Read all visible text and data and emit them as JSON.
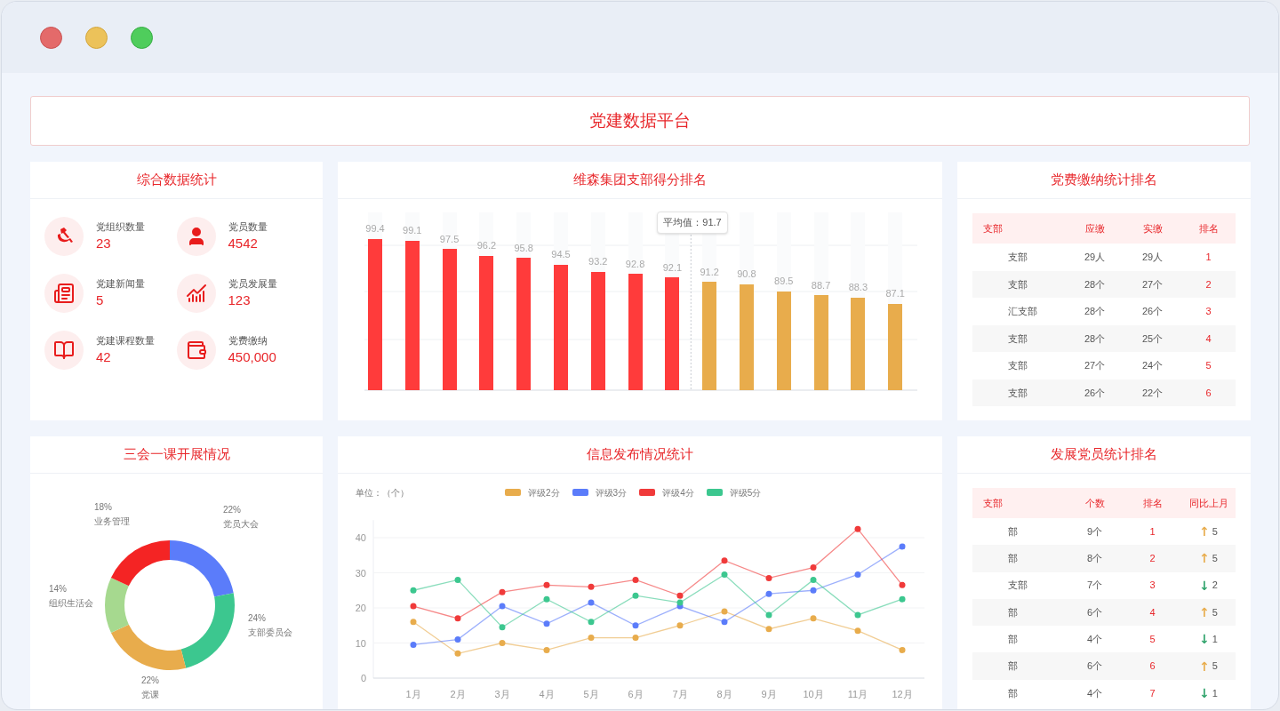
{
  "title": "党建数据平台",
  "stats": {
    "title": "综合数据统计",
    "items": [
      {
        "kind": "party",
        "label": "党组织数量",
        "value": "23"
      },
      {
        "kind": "member",
        "label": "党员数量",
        "value": "4542"
      },
      {
        "kind": "news",
        "label": "党建新闻量",
        "value": "5"
      },
      {
        "kind": "growth",
        "label": "党员发展量",
        "value": "123"
      },
      {
        "kind": "course",
        "label": "党建课程数量",
        "value": "42"
      },
      {
        "kind": "fee",
        "label": "党费缴纳",
        "value": "450,000"
      }
    ]
  },
  "ranking": {
    "title": "维森集团支部得分排名",
    "average": "平均值：91.7",
    "bars": [
      {
        "value": "99.4",
        "level": 0.851,
        "color": "#ff3b3b"
      },
      {
        "value": "99.1",
        "level": 0.842,
        "color": "#ff3b3b"
      },
      {
        "value": "97.5",
        "level": 0.795,
        "color": "#ff3b3b"
      },
      {
        "value": "96.2",
        "level": 0.756,
        "color": "#ff3b3b"
      },
      {
        "value": "95.8",
        "level": 0.744,
        "color": "#ff3b3b"
      },
      {
        "value": "94.5",
        "level": 0.706,
        "color": "#ff3b3b"
      },
      {
        "value": "93.2",
        "level": 0.667,
        "color": "#ff3b3b"
      },
      {
        "value": "92.8",
        "level": 0.655,
        "color": "#ff3b3b"
      },
      {
        "value": "92.1",
        "level": 0.634,
        "color": "#ff3b3b"
      },
      {
        "value": "91.2",
        "level": 0.608,
        "color": "#e8ac4c"
      },
      {
        "value": "90.8",
        "level": 0.596,
        "color": "#e8ac4c"
      },
      {
        "value": "89.5",
        "level": 0.557,
        "color": "#e8ac4c"
      },
      {
        "value": "88.7",
        "level": 0.534,
        "color": "#e8ac4c"
      },
      {
        "value": "88.3",
        "level": 0.522,
        "color": "#e8ac4c"
      },
      {
        "value": "87.1",
        "level": 0.486,
        "color": "#e8ac4c"
      }
    ]
  },
  "fees": {
    "title": "党费缴纳统计排名",
    "columns": [
      "支部",
      "应缴",
      "实缴",
      "排名"
    ],
    "rows": [
      [
        "支部",
        "29人",
        "29人",
        "1"
      ],
      [
        "支部",
        "28个",
        "27个",
        "2"
      ],
      [
        "汇支部",
        "28个",
        "26个",
        "3"
      ],
      [
        "支部",
        "28个",
        "25个",
        "4"
      ],
      [
        "支部",
        "27个",
        "24个",
        "5"
      ],
      [
        "支部",
        "26个",
        "22个",
        "6"
      ]
    ]
  },
  "meetings": {
    "title": "三会一课开展情况",
    "chart_data": {
      "type": "donut",
      "categories": [
        "党员大会",
        "支部委员会",
        "党课",
        "组织生活会",
        "业务管理"
      ],
      "values": [
        22,
        24,
        22,
        14,
        18
      ],
      "colors": [
        "#5b7cfa",
        "#3cc78f",
        "#e8ac4c",
        "#a6d98f",
        "#f42424"
      ],
      "value_labels": [
        "22%",
        "24%",
        "22%",
        "14%",
        "18%"
      ]
    }
  },
  "posts": {
    "title": "信息发布情况统计",
    "unit": "单位：（个）",
    "chart_data": {
      "type": "line",
      "x": [
        "1月",
        "2月",
        "3月",
        "4月",
        "5月",
        "6月",
        "7月",
        "8月",
        "9月",
        "10月",
        "11月",
        "12月"
      ],
      "ylim": [
        0,
        45
      ],
      "yticks": [
        0,
        10,
        20,
        30,
        40
      ],
      "grid": true,
      "legend": "top",
      "series": [
        {
          "name": "评级2分",
          "color": "#e8ac4c",
          "marker": "circle",
          "values": [
            16,
            7,
            10,
            8,
            11.5,
            11.5,
            15,
            19,
            14,
            17,
            13.5,
            8
          ]
        },
        {
          "name": "评级3分",
          "color": "#5b7cfa",
          "marker": "circle",
          "values": [
            9.5,
            11,
            20.5,
            15.5,
            21.5,
            15,
            20.5,
            16,
            24,
            25,
            29.5,
            37.5
          ]
        },
        {
          "name": "评级4分",
          "color": "#f03a3a",
          "marker": "circle",
          "values": [
            20.5,
            17,
            24.5,
            26.5,
            26,
            28,
            23.5,
            33.5,
            28.5,
            31.5,
            42.5,
            26.5
          ]
        },
        {
          "name": "评级5分",
          "color": "#3cc78f",
          "marker": "circle",
          "values": [
            25,
            28,
            14.5,
            22.5,
            16,
            23.5,
            21.5,
            29.5,
            18,
            28,
            18,
            22.5
          ]
        }
      ]
    }
  },
  "growth": {
    "title": "发展党员统计排名",
    "columns": [
      "支部",
      "个数",
      "排名",
      "同比上月"
    ],
    "rows": [
      {
        "branch": "部",
        "count": "9个",
        "rank": "1",
        "arrow": "↑",
        "color": "#e8ac4c",
        "change": "5"
      },
      {
        "branch": "部",
        "count": "8个",
        "rank": "2",
        "arrow": "↑",
        "color": "#e8ac4c",
        "change": "5"
      },
      {
        "branch": "支部",
        "count": "7个",
        "rank": "3",
        "arrow": "↓",
        "color": "#2fa36b",
        "change": "2"
      },
      {
        "branch": "部",
        "count": "6个",
        "rank": "4",
        "arrow": "↑",
        "color": "#e8ac4c",
        "change": "5"
      },
      {
        "branch": "部",
        "count": "4个",
        "rank": "5",
        "arrow": "↓",
        "color": "#2fa36b",
        "change": "1"
      },
      {
        "branch": "部",
        "count": "6个",
        "rank": "6",
        "arrow": "↑",
        "color": "#e8ac4c",
        "change": "5"
      },
      {
        "branch": "部",
        "count": "4个",
        "rank": "7",
        "arrow": "↓",
        "color": "#2fa36b",
        "change": "1"
      }
    ]
  }
}
